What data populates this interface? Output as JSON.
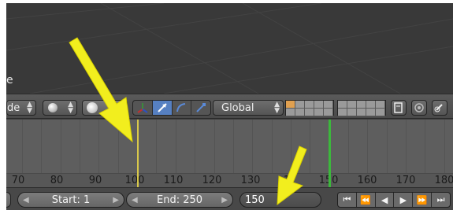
{
  "viewport": {
    "edge_label": "e"
  },
  "header": {
    "mode_label": "de",
    "orientation_label": "Global",
    "manipulators": [
      "translate",
      "rotate",
      "scale"
    ]
  },
  "timeline": {
    "tick_labels": [
      "70",
      "80",
      "90",
      "100",
      "110",
      "120",
      "130",
      "140",
      "150",
      "160",
      "170",
      "180"
    ],
    "visible_tick_labels": [
      "70",
      "80",
      "90",
      "100",
      "110",
      "120",
      "130",
      "1",
      "150",
      "160",
      "170",
      "180"
    ],
    "current_frame_marker_color": "#d8c84a",
    "keyframe_marker_color": "#3cb83c",
    "yellow_marker_frame": 100,
    "green_marker_frame": 150
  },
  "bottom_bar": {
    "start_field": "Start: 1",
    "end_field": "End: 250",
    "current_frame_field": "150",
    "playback_buttons": [
      "⏮",
      "⏪",
      "◀",
      "▶",
      "⏩",
      "⏭"
    ]
  },
  "annotation": {
    "arrow_color": "#f2ee1e"
  }
}
